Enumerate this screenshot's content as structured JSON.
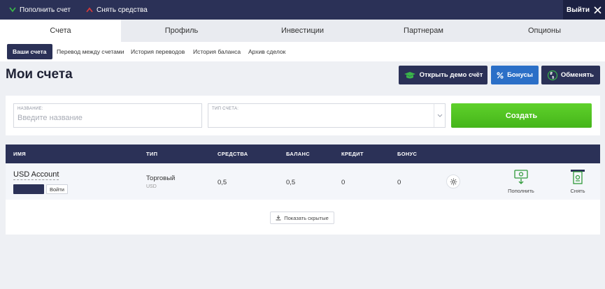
{
  "topbar": {
    "deposit_label": "Пополнить счет",
    "withdraw_label": "Снять средства",
    "logout_label": "Выйти"
  },
  "tabs": [
    {
      "label": "Счета"
    },
    {
      "label": "Профиль"
    },
    {
      "label": "Инвестиции"
    },
    {
      "label": "Партнерам"
    },
    {
      "label": "Опционы"
    }
  ],
  "subtabs": [
    {
      "label": "Ваши счета"
    },
    {
      "label": "Перевод между счетами"
    },
    {
      "label": "История переводов"
    },
    {
      "label": "История баланса"
    },
    {
      "label": "Архив сделок"
    }
  ],
  "page_title": "Мои счета",
  "header_buttons": {
    "demo": "Открыть демо счёт",
    "bonus": "Бонусы",
    "exchange": "Обменять"
  },
  "create": {
    "name_label": "НАЗВАНИЕ:",
    "name_placeholder": "Введите название",
    "type_label": "ТИП СЧЕТА:",
    "create_label": "Создать"
  },
  "table": {
    "columns": [
      "ИМЯ",
      "ТИП",
      "СРЕДСТВА",
      "БАЛАНС",
      "КРЕДИТ",
      "БОНУС"
    ],
    "rows": [
      {
        "name": "USD Account",
        "login_label": "Войти",
        "type": "Торговый",
        "currency": "USD",
        "funds": "0,5",
        "balance": "0,5",
        "credit": "0",
        "bonus": "0",
        "deposit_label": "Пополнить",
        "withdraw_label": "Снять"
      }
    ],
    "show_hidden_label": "Показать скрытые"
  },
  "colors": {
    "navy": "#2b3157",
    "accent_blue": "#2b6fc7",
    "create_green": "#52c421",
    "icon_green": "#2f9a3a",
    "withdraw_red": "#d23a3a",
    "deposit_green": "#3ab54a"
  },
  "icons": [
    "check-down-icon",
    "arrow-up-icon",
    "close-icon",
    "graduation-cap-icon",
    "percent-icon",
    "exchange-icon",
    "chevron-down-icon",
    "gear-icon",
    "cash-in-icon",
    "cash-out-icon",
    "download-icon"
  ]
}
